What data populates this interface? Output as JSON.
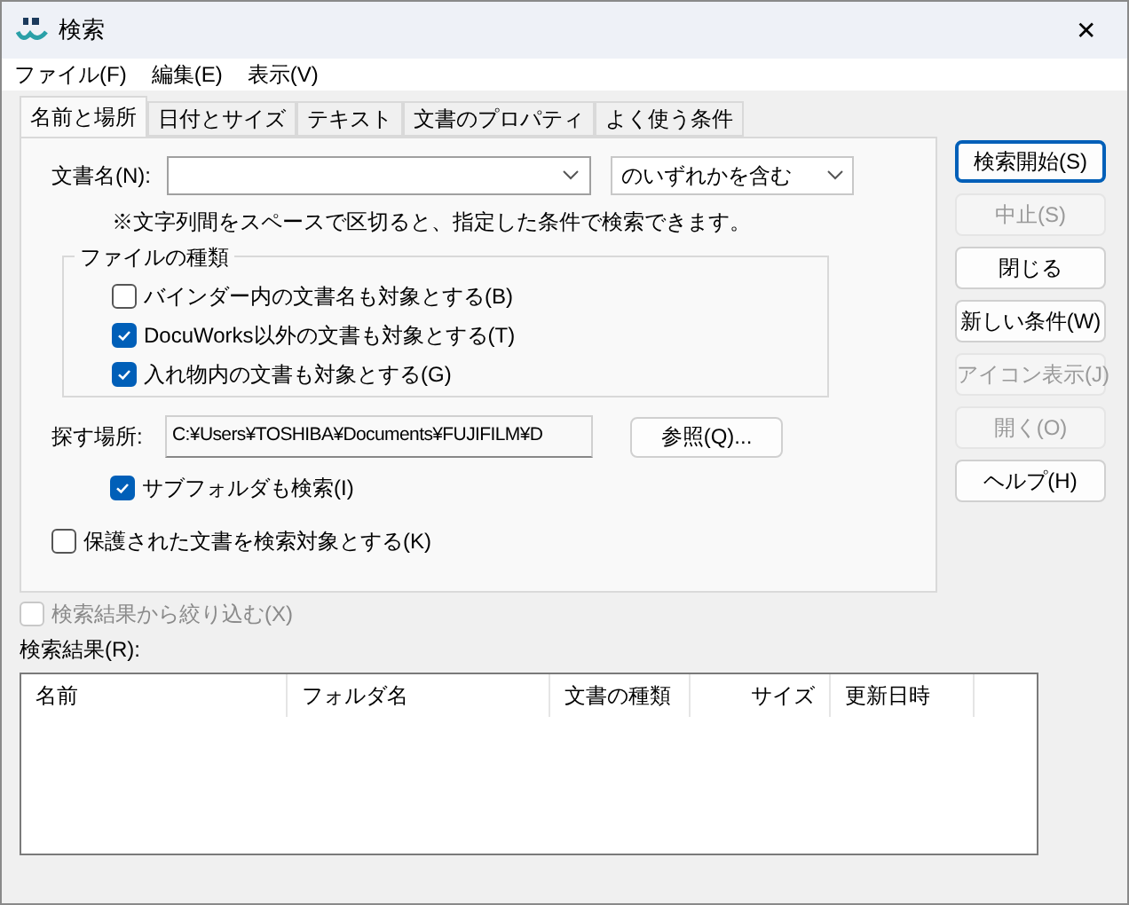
{
  "window": {
    "title": "検索",
    "close": "✕"
  },
  "menu": [
    "ファイル(F)",
    "編集(E)",
    "表示(V)"
  ],
  "tabs": [
    {
      "label": "名前と場所",
      "selected": true
    },
    {
      "label": "日付とサイズ",
      "selected": false
    },
    {
      "label": "テキスト",
      "selected": false
    },
    {
      "label": "文書のプロパティ",
      "selected": false
    },
    {
      "label": "よく使う条件",
      "selected": false
    }
  ],
  "name_field": {
    "label": "文書名(N):",
    "match": "のいずれかを含む"
  },
  "hint": "※文字列間をスペースで区切ると、指定した条件で検索できます。",
  "file_types": {
    "title": "ファイルの種類",
    "options": [
      {
        "label": "バインダー内の文書名も対象とする(B)",
        "checked": false
      },
      {
        "label": "DocuWorks以外の文書も対象とする(T)",
        "checked": true
      },
      {
        "label": "入れ物内の文書も対象とする(G)",
        "checked": true
      }
    ]
  },
  "location": {
    "label": "探す場所:",
    "value": "C:¥Users¥TOSHIBA¥Documents¥FUJIFILM¥D",
    "browse": "参照(Q)..."
  },
  "subfolders": {
    "label": "サブフォルダも検索(I)",
    "checked": true
  },
  "protected": {
    "label": "保護された文書を検索対象とする(K)",
    "checked": false
  },
  "buttons": [
    {
      "label": "検索開始(S)",
      "disabled": false,
      "default": true
    },
    {
      "label": "中止(S)",
      "disabled": true,
      "default": false
    },
    {
      "label": "閉じる",
      "disabled": false,
      "default": false
    },
    {
      "label": "新しい条件(W)",
      "disabled": false,
      "default": false
    },
    {
      "label": "アイコン表示(J)",
      "disabled": true,
      "default": false
    },
    {
      "label": "開く(O)",
      "disabled": true,
      "default": false
    },
    {
      "label": "ヘルプ(H)",
      "disabled": false,
      "default": false
    }
  ],
  "refine": {
    "label": "検索結果から絞り込む(X)",
    "checked": false,
    "disabled": true
  },
  "results": {
    "label": "検索結果(R):",
    "columns": [
      {
        "label": "名前",
        "kind": "text"
      },
      {
        "label": "フォルダ名",
        "kind": "text"
      },
      {
        "label": "文書の種類",
        "kind": "text"
      },
      {
        "label": "サイズ",
        "kind": "number"
      },
      {
        "label": "更新日時",
        "kind": "text"
      }
    ]
  }
}
